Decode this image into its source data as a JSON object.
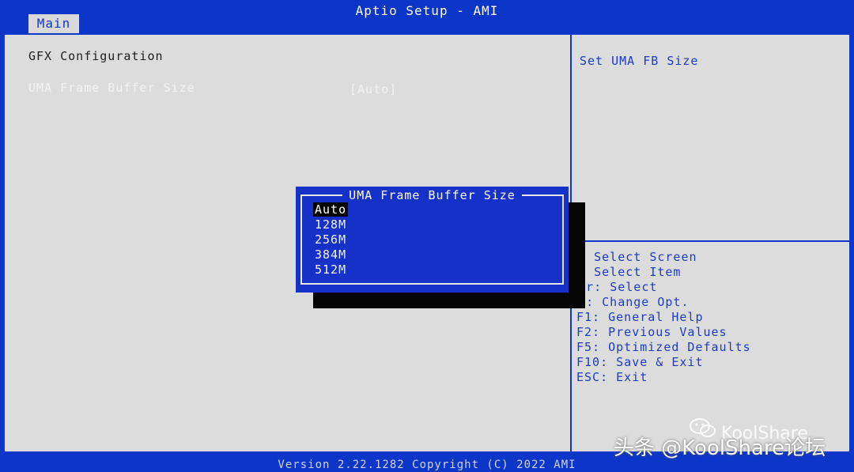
{
  "header": {
    "title": "Aptio Setup - AMI"
  },
  "tabs": [
    {
      "label": "Main"
    }
  ],
  "left": {
    "section_title": "GFX Configuration",
    "items": [
      {
        "label": "UMA Frame Buffer Size",
        "value": "[Auto]"
      }
    ]
  },
  "help": {
    "text": "Set UMA FB Size"
  },
  "keys": [
    "++: Select Screen",
    "↑↓: Select Item",
    "Enter: Select",
    "+/-: Change Opt.",
    "F1: General Help",
    "F2: Previous Values",
    "F5: Optimized Defaults",
    "F10: Save & Exit",
    "ESC: Exit"
  ],
  "popup": {
    "title": "UMA Frame Buffer Size",
    "options": [
      "Auto",
      "128M",
      "256M",
      "384M",
      "512M"
    ],
    "selected": "Auto"
  },
  "footer": {
    "text": "Version 2.22.1282 Copyright (C) 2022 AMI"
  },
  "watermark": {
    "text": "头条 @KoolShare论坛",
    "brand": "KoolShare"
  },
  "colors": {
    "bios_blue": "#0c36c8",
    "panel_gray": "#dcdcdc",
    "highlight": "#000000"
  }
}
